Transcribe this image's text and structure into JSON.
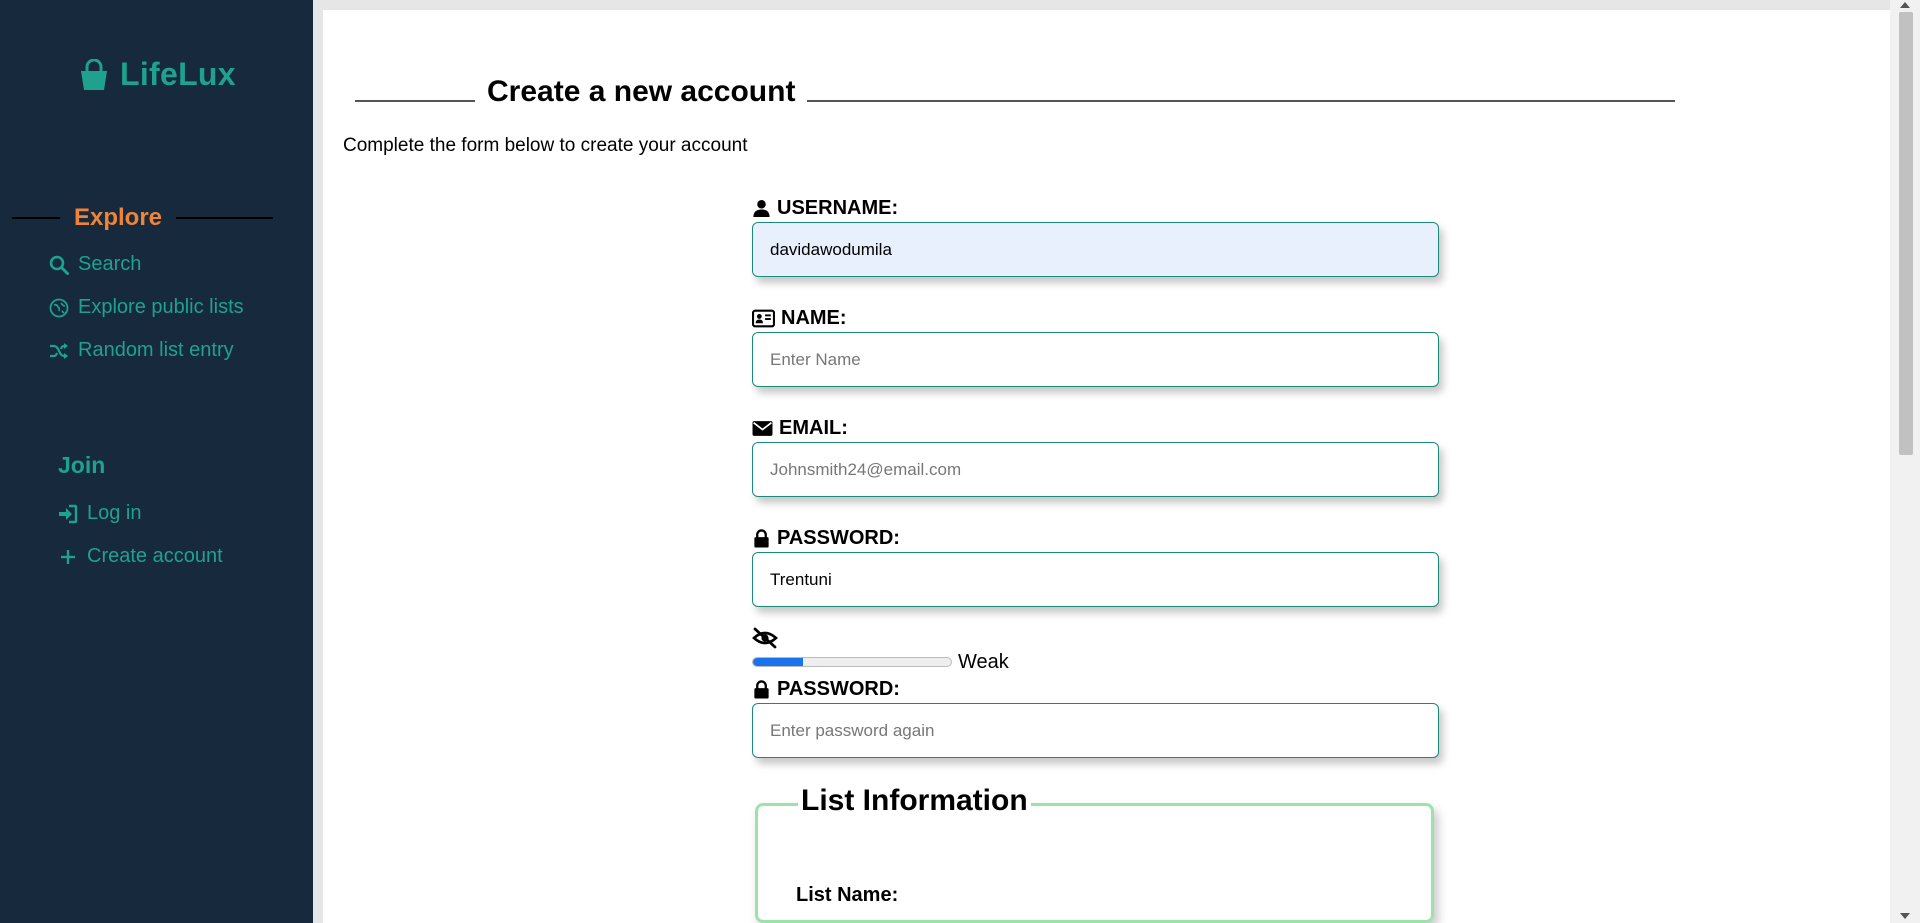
{
  "app": {
    "name": "LifeLux",
    "logo_icon": "basket-icon"
  },
  "sidebar": {
    "explore": {
      "title": "Explore",
      "items": [
        {
          "label": "Search",
          "icon": "search-icon"
        },
        {
          "label": "Explore public lists",
          "icon": "compass-icon"
        },
        {
          "label": "Random list entry",
          "icon": "shuffle-icon"
        }
      ]
    },
    "join": {
      "title": "Join",
      "items": [
        {
          "label": "Log in",
          "icon": "login-icon"
        },
        {
          "label": "Create account",
          "icon": "plus-icon"
        }
      ]
    }
  },
  "page": {
    "title": "Create a new account",
    "subtitle": "Complete the form below to create your account"
  },
  "form": {
    "username": {
      "label": "USERNAME:",
      "value": "davidawodumila",
      "placeholder": ""
    },
    "name": {
      "label": "NAME:",
      "value": "",
      "placeholder": "Enter Name"
    },
    "email": {
      "label": "EMAIL:",
      "value": "",
      "placeholder": "Johnsmith24@email.com"
    },
    "password": {
      "label": "PASSWORD:",
      "value": "Trentuni",
      "placeholder": ""
    },
    "strength": {
      "label": "Weak",
      "level": 0.25
    },
    "confirm_password": {
      "label": "PASSWORD:",
      "value": "",
      "placeholder": "Enter password again"
    },
    "list_info": {
      "legend": "List Information",
      "list_name_label": "List Name:"
    }
  },
  "colors": {
    "sidebar_bg": "#17293d",
    "accent_teal": "#1fa28d",
    "accent_orange": "#ee8438",
    "input_border": "#1b8a78",
    "fieldset_border": "#9be3a9",
    "meter_fill": "#1a73e8"
  }
}
